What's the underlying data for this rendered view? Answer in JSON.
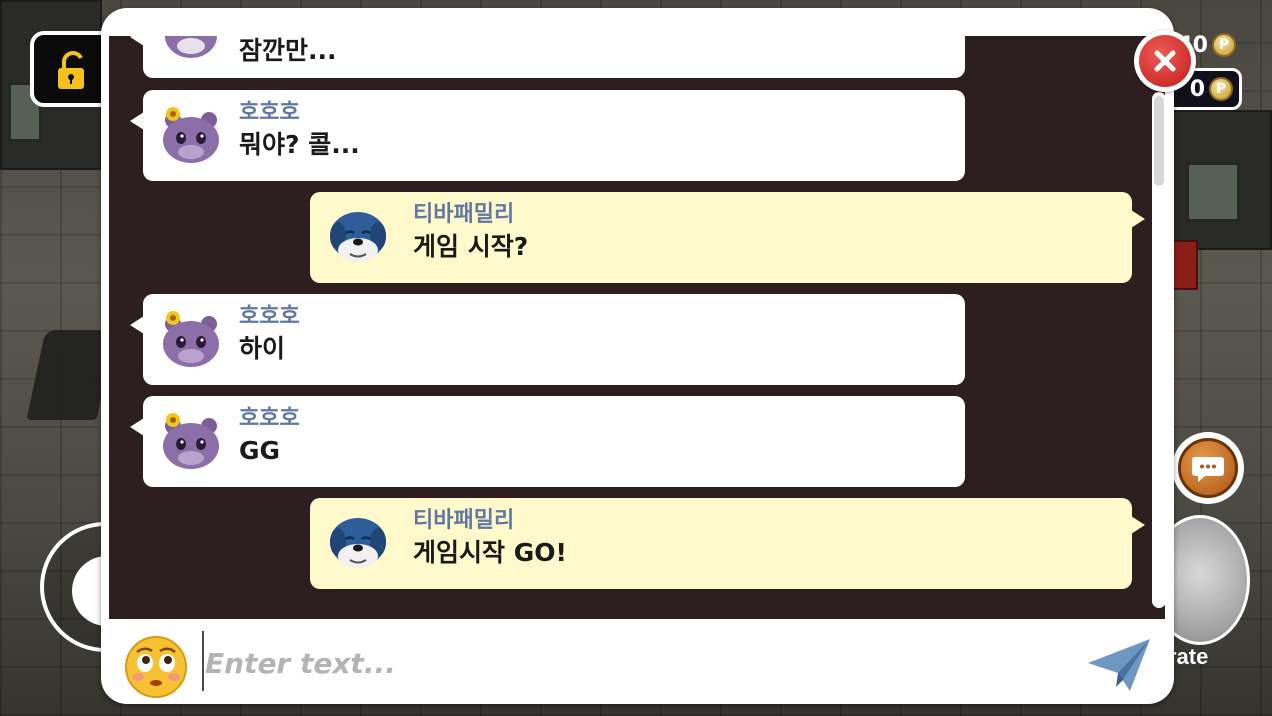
{
  "hud": {
    "coin_top_value": "40",
    "coin_bottom_value": "0",
    "coin_symbol": "P",
    "rate_label": "rate"
  },
  "chat": {
    "messages": [
      {
        "side": "left",
        "name": "",
        "text": "잠깐만...",
        "avatar": "purple-hamster-avatar"
      },
      {
        "side": "left",
        "name": "호호호",
        "text": "뭐야? 콜...",
        "avatar": "purple-hamster-avatar"
      },
      {
        "side": "right",
        "name": "티바패밀리",
        "text": "게임 시작?",
        "avatar": "blue-dog-avatar"
      },
      {
        "side": "left",
        "name": "호호호",
        "text": "하이",
        "avatar": "purple-hamster-avatar"
      },
      {
        "side": "left",
        "name": "호호호",
        "text": "GG",
        "avatar": "purple-hamster-avatar"
      },
      {
        "side": "right",
        "name": "티바패밀리",
        "text": "게임시작 GO!",
        "avatar": "blue-dog-avatar"
      }
    ],
    "input_placeholder": "Enter text...",
    "input_value": ""
  },
  "colors": {
    "chat_background": "#2d1f1f",
    "self_bubble": "#fff9cc",
    "other_bubble": "#ffffff",
    "name_color": "#6178a3",
    "close_red": "#d42a25"
  }
}
